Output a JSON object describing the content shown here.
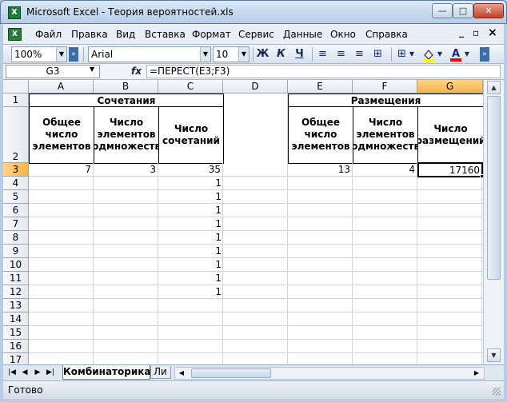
{
  "window": {
    "title": "Microsoft Excel - Теория вероятностей.xls",
    "minimize": "—",
    "restore": "□",
    "close": "✕"
  },
  "menu": {
    "items": [
      {
        "label": "Файл"
      },
      {
        "label": "Правка"
      },
      {
        "label": "Вид"
      },
      {
        "label": "Вставка"
      },
      {
        "label": "Формат"
      },
      {
        "label": "Сервис"
      },
      {
        "label": "Данные"
      },
      {
        "label": "Окно"
      },
      {
        "label": "Справка"
      }
    ],
    "doc_min": "_",
    "doc_restore": "▫",
    "doc_close": "×"
  },
  "toolbar": {
    "zoom": "100%",
    "font_name": "Arial",
    "font_size": "10",
    "bold": "Ж",
    "italic": "К",
    "underline": "Ч",
    "fill_color": "#ffff00",
    "font_color": "#ff0000"
  },
  "formula_bar": {
    "name_box": "G3",
    "fx": "fx",
    "formula": "=ПЕРЕСТ(E3;F3)"
  },
  "grid": {
    "columns": [
      "A",
      "B",
      "C",
      "D",
      "E",
      "F",
      "G"
    ],
    "selected_column": "G",
    "rows": [
      "1",
      "2",
      "3",
      "4",
      "5",
      "6",
      "7",
      "8",
      "9",
      "10",
      "11",
      "12",
      "13",
      "14",
      "15",
      "16",
      "17"
    ],
    "selected_row": "3",
    "header_combinations": "Сочетания",
    "header_placements": "Размещения",
    "a2": "Общее число элементов",
    "b2": "Число элементов подмножества",
    "c2": "Число сочетаний",
    "e2": "Общее число элементов",
    "f2": "Число элементов подмножества",
    "g2": "Число размещений",
    "a3": "7",
    "b3": "3",
    "c3": "35",
    "e3": "13",
    "f3": "4",
    "g3": "17160",
    "c_col_values": [
      "1",
      "1",
      "1",
      "1",
      "1",
      "1",
      "1",
      "1",
      "1"
    ]
  },
  "sheets": {
    "active": "Комбинаторика",
    "next": "Ли"
  },
  "status": {
    "text": "Готово"
  }
}
